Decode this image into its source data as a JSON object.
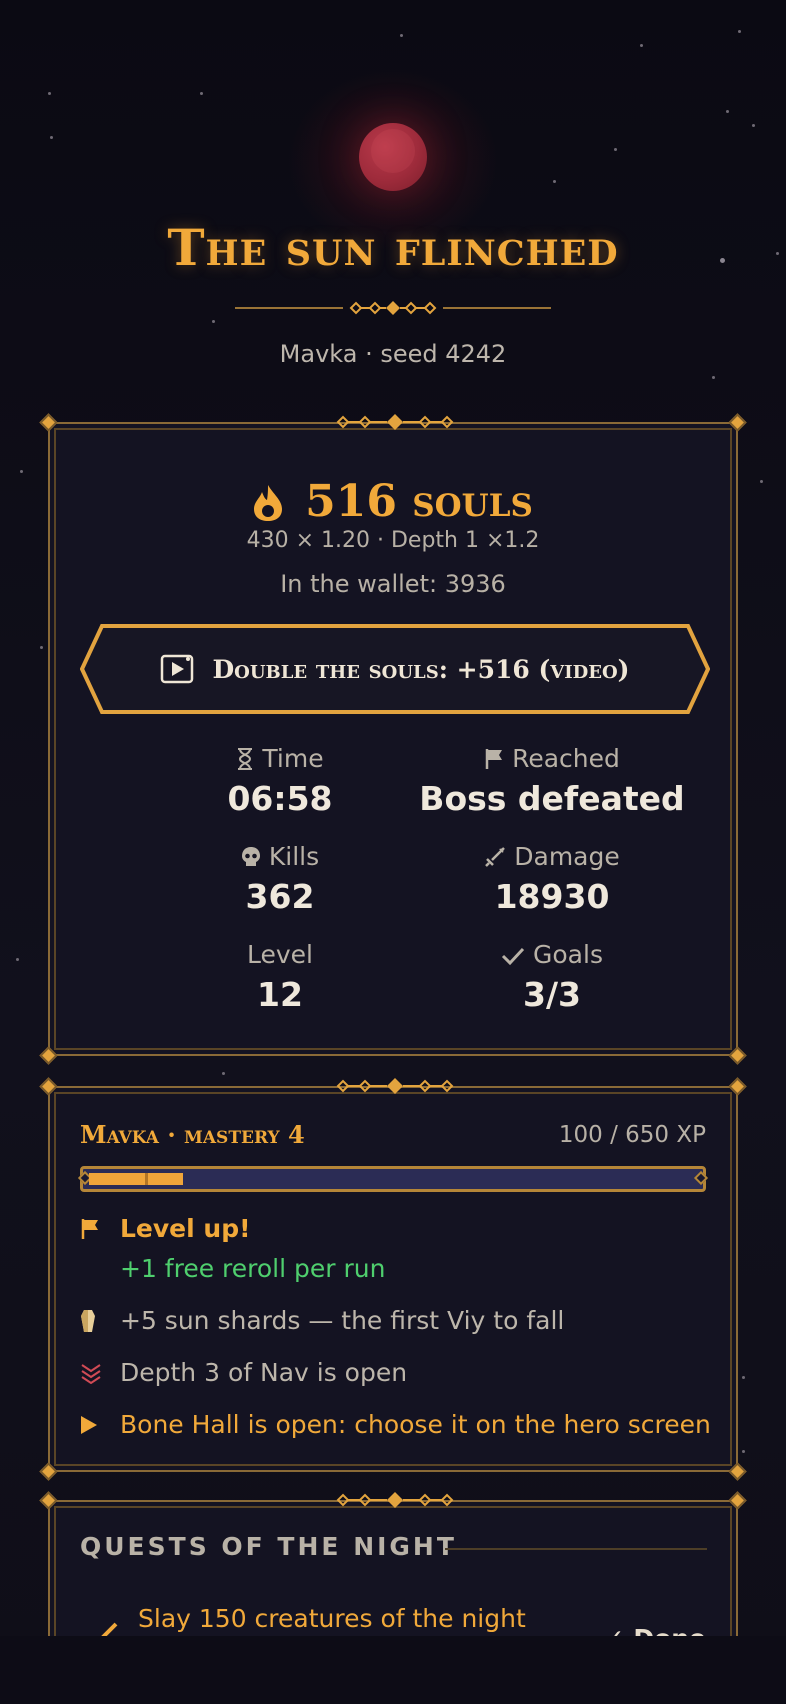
{
  "header": {
    "title": "The sun flinched",
    "subtitle": "Mavka · seed 4242"
  },
  "souls": {
    "amount_label": "516 souls",
    "detail": "430 × 1.20 · Depth 1 ×1.2",
    "wallet": "In the wallet: 3936",
    "double_button": "Double the souls: +516 (video)"
  },
  "stats": [
    {
      "label": "Time",
      "value": "06:58",
      "icon": "hourglass-icon"
    },
    {
      "label": "Reached",
      "value": "Boss defeated",
      "icon": "flag-icon"
    },
    {
      "label": "Kills",
      "value": "362",
      "icon": "skull-icon"
    },
    {
      "label": "Damage",
      "value": "18930",
      "icon": "sword-icon"
    },
    {
      "label": "Level",
      "value": "12",
      "icon": ""
    },
    {
      "label": "Goals",
      "value": "3/3",
      "icon": "check-icon"
    }
  ],
  "mastery": {
    "title": "Mavka · mastery 4",
    "xp_text": "100 / 650 XP",
    "xp_fraction": 0.154,
    "rewards": {
      "level_up": "Level up!",
      "free_reroll": "+1 free reroll per run",
      "sun_shards": "+5 sun shards — the first Viy to fall",
      "depth": "Depth 3 of Nav is open",
      "bone_hall": "Bone Hall is open: choose it on the hero screen"
    }
  },
  "quests": {
    "title": "QUESTS OF THE NIGHT",
    "items": [
      {
        "label": "Slay 150 creatures of the night",
        "status": "Done"
      }
    ]
  },
  "colors": {
    "accent": "#f1a93a",
    "background": "#0d0c15",
    "panel": "#141322",
    "success": "#4fcf6e",
    "moon": "#9e2b3b"
  }
}
